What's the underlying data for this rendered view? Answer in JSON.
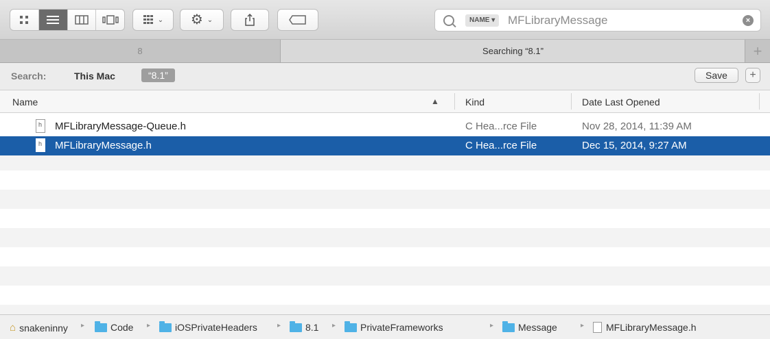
{
  "toolbar": {
    "view_buttons": [
      "icon-view",
      "list-view",
      "column-view",
      "cover-flow-view"
    ],
    "search": {
      "token": "NAME ▾",
      "value": "MFLibraryMessage",
      "clear_label": "×"
    }
  },
  "tabs": {
    "items": [
      "8",
      "Searching “8.1”"
    ],
    "add_label": "+"
  },
  "scope": {
    "label": "Search:",
    "this_mac": "This Mac",
    "chip": "“8.1”",
    "save_label": "Save",
    "add_label": "+"
  },
  "columns": {
    "name": "Name",
    "kind": "Kind",
    "date": "Date Last Opened"
  },
  "files": [
    {
      "name": "MFLibraryMessage-Queue.h",
      "kind": "C Hea...rce File",
      "date": "Nov 28, 2014, 11:39 AM"
    },
    {
      "name": "MFLibraryMessage.h",
      "kind": "C Hea...rce File",
      "date": "Dec 15, 2014, 9:27 AM"
    }
  ],
  "path": [
    "snakeninny",
    "Code",
    "iOSPrivateHeaders",
    "8.1",
    "PrivateFrameworks",
    "Message",
    "MFLibraryMessage.h"
  ],
  "colors": {
    "selection": "#1b5ea8",
    "folder": "#4fb2e6"
  }
}
